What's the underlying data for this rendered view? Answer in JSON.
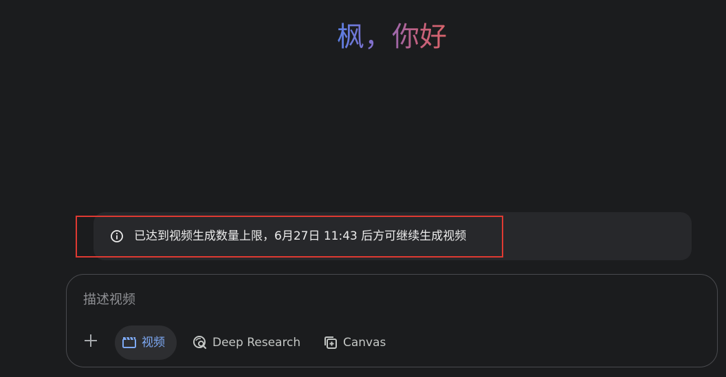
{
  "greeting": "枫，你好",
  "notice": {
    "text": "已达到视频生成数量上限，6月27日 11:43 后方可继续生成视频",
    "icon": "info-icon"
  },
  "composer": {
    "placeholder": "描述视频",
    "tools": {
      "video_label": "视频",
      "deep_research_label": "Deep Research",
      "canvas_label": "Canvas"
    }
  },
  "colors": {
    "background": "#1b1c1e",
    "notice_bg": "#27282b",
    "highlight_border": "#e03a32",
    "active_chip_text": "#7eaaf5",
    "greeting_gradient_start": "#5b7fe3",
    "greeting_gradient_end": "#d9646b"
  }
}
